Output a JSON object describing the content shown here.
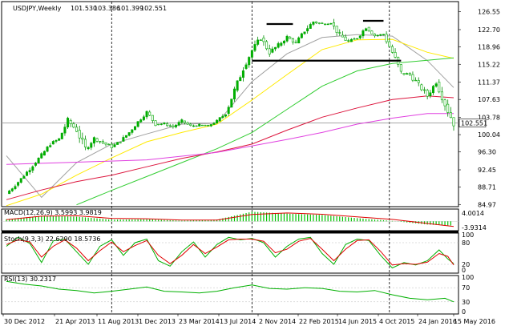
{
  "chart_data": {
    "type": "line",
    "header": {
      "symbol": "USDJPY,Weekly",
      "open": "101.530",
      "high": "103.386",
      "low": "101.399",
      "close": "102.551"
    },
    "price_axis": {
      "ticks": [
        126.55,
        122.7,
        118.96,
        115.22,
        111.37,
        107.63,
        103.78,
        100.04,
        96.3,
        92.45,
        88.71,
        84.97
      ],
      "tick_labels": [
        "126.55",
        "122.70",
        "118.96",
        "115.22",
        "111.37",
        "107.63",
        "103.78",
        "100.04",
        "96.30",
        "92.45",
        "88.71",
        "84.97"
      ],
      "ylim": [
        84.5,
        128.4
      ],
      "current_price_label": "102.551",
      "current_price": 102.551
    },
    "x_axis": {
      "labels": [
        "30 Dec 2012",
        "21 Apr 2013",
        "11 Aug 2013",
        "1 Dec 2013",
        "23 Mar 2014",
        "13 Jul 2014",
        "2 Nov 2014",
        "22 Feb 2015",
        "14 Jun 2015",
        "4 Oct 2015",
        "24 Jan 2016",
        "15 May 2016"
      ],
      "dashed_separators": [
        "1 Dec 2013",
        "2 Nov 2014",
        "24 Jan 2016"
      ]
    },
    "price_series": [
      {
        "t": 0,
        "o": 85.5,
        "h": 87.8,
        "l": 85.0,
        "c": 87.3
      },
      {
        "t": 3,
        "o": 87.3,
        "h": 89.5,
        "l": 86.9,
        "c": 89.1
      },
      {
        "t": 6,
        "o": 89.1,
        "h": 91.8,
        "l": 88.8,
        "c": 91.2
      },
      {
        "t": 9,
        "o": 91.2,
        "h": 94.0,
        "l": 90.6,
        "c": 93.4
      },
      {
        "t": 12,
        "o": 93.4,
        "h": 96.2,
        "l": 92.8,
        "c": 95.6
      },
      {
        "t": 15,
        "o": 95.6,
        "h": 98.4,
        "l": 95.0,
        "c": 98.0
      },
      {
        "t": 18,
        "o": 98.0,
        "h": 99.6,
        "l": 96.8,
        "c": 99.1
      },
      {
        "t": 21,
        "o": 99.1,
        "h": 103.7,
        "l": 98.4,
        "c": 103.1
      },
      {
        "t": 24,
        "o": 103.1,
        "h": 103.7,
        "l": 98.6,
        "c": 101.0
      },
      {
        "t": 27,
        "o": 101.0,
        "h": 101.6,
        "l": 94.5,
        "c": 97.0
      },
      {
        "t": 30,
        "o": 97.0,
        "h": 99.8,
        "l": 95.2,
        "c": 99.2
      },
      {
        "t": 33,
        "o": 99.2,
        "h": 100.6,
        "l": 97.8,
        "c": 98.3
      },
      {
        "t": 36,
        "o": 98.3,
        "h": 99.5,
        "l": 96.3,
        "c": 97.4
      },
      {
        "t": 39,
        "o": 97.4,
        "h": 99.2,
        "l": 96.6,
        "c": 98.6
      },
      {
        "t": 42,
        "o": 98.6,
        "h": 101.3,
        "l": 98.1,
        "c": 100.5
      },
      {
        "t": 45,
        "o": 100.5,
        "h": 103.2,
        "l": 100.0,
        "c": 102.8
      },
      {
        "t": 48,
        "o": 102.8,
        "h": 105.4,
        "l": 102.3,
        "c": 104.9
      },
      {
        "t": 51,
        "o": 104.9,
        "h": 105.3,
        "l": 101.8,
        "c": 102.3
      },
      {
        "t": 54,
        "o": 102.3,
        "h": 103.4,
        "l": 101.4,
        "c": 102.4
      },
      {
        "t": 57,
        "o": 102.4,
        "h": 103.1,
        "l": 100.8,
        "c": 101.7
      },
      {
        "t": 60,
        "o": 101.7,
        "h": 103.6,
        "l": 101.2,
        "c": 103.0
      },
      {
        "t": 63,
        "o": 103.0,
        "h": 103.6,
        "l": 101.4,
        "c": 101.9
      },
      {
        "t": 66,
        "o": 101.9,
        "h": 102.8,
        "l": 101.1,
        "c": 102.1
      },
      {
        "t": 69,
        "o": 102.1,
        "h": 102.9,
        "l": 101.4,
        "c": 101.9
      },
      {
        "t": 72,
        "o": 101.9,
        "h": 103.4,
        "l": 101.6,
        "c": 103.0
      },
      {
        "t": 75,
        "o": 103.0,
        "h": 105.4,
        "l": 102.5,
        "c": 104.6
      },
      {
        "t": 78,
        "o": 104.6,
        "h": 110.2,
        "l": 104.2,
        "c": 109.6
      },
      {
        "t": 81,
        "o": 109.6,
        "h": 114.8,
        "l": 108.9,
        "c": 114.3
      },
      {
        "t": 84,
        "o": 114.3,
        "h": 118.8,
        "l": 113.8,
        "c": 118.2
      },
      {
        "t": 87,
        "o": 118.2,
        "h": 121.8,
        "l": 116.8,
        "c": 120.9
      },
      {
        "t": 90,
        "o": 120.9,
        "h": 121.4,
        "l": 116.0,
        "c": 117.8
      },
      {
        "t": 93,
        "o": 117.8,
        "h": 121.0,
        "l": 117.0,
        "c": 119.3
      },
      {
        "t": 96,
        "o": 119.3,
        "h": 122.0,
        "l": 118.6,
        "c": 121.1
      },
      {
        "t": 99,
        "o": 121.1,
        "h": 121.6,
        "l": 118.4,
        "c": 119.8
      },
      {
        "t": 102,
        "o": 119.8,
        "h": 122.9,
        "l": 119.3,
        "c": 122.4
      },
      {
        "t": 105,
        "o": 122.4,
        "h": 125.9,
        "l": 121.9,
        "c": 124.4
      },
      {
        "t": 108,
        "o": 124.4,
        "h": 125.1,
        "l": 122.6,
        "c": 123.9
      },
      {
        "t": 111,
        "o": 123.9,
        "h": 124.8,
        "l": 122.9,
        "c": 124.2
      },
      {
        "t": 114,
        "o": 124.2,
        "h": 125.4,
        "l": 120.6,
        "c": 121.5
      },
      {
        "t": 117,
        "o": 121.5,
        "h": 122.0,
        "l": 116.5,
        "c": 120.1
      },
      {
        "t": 120,
        "o": 120.1,
        "h": 121.7,
        "l": 119.4,
        "c": 120.9
      },
      {
        "t": 123,
        "o": 120.9,
        "h": 123.9,
        "l": 120.4,
        "c": 123.2
      },
      {
        "t": 126,
        "o": 123.2,
        "h": 123.6,
        "l": 120.8,
        "c": 121.4
      },
      {
        "t": 129,
        "o": 121.4,
        "h": 122.2,
        "l": 120.6,
        "c": 121.7
      },
      {
        "t": 132,
        "o": 121.7,
        "h": 121.9,
        "l": 116.0,
        "c": 117.8
      },
      {
        "t": 135,
        "o": 117.8,
        "h": 118.4,
        "l": 110.9,
        "c": 113.3
      },
      {
        "t": 138,
        "o": 113.3,
        "h": 114.6,
        "l": 111.4,
        "c": 113.0
      },
      {
        "t": 141,
        "o": 113.0,
        "h": 113.5,
        "l": 108.7,
        "c": 110.8
      },
      {
        "t": 144,
        "o": 110.8,
        "h": 112.6,
        "l": 107.8,
        "c": 108.4
      },
      {
        "t": 147,
        "o": 108.4,
        "h": 112.2,
        "l": 107.6,
        "c": 111.4
      },
      {
        "t": 150,
        "o": 111.4,
        "h": 111.9,
        "l": 105.5,
        "c": 106.6
      },
      {
        "t": 153,
        "o": 106.6,
        "h": 107.0,
        "l": 99.0,
        "c": 102.551
      }
    ],
    "moving_averages": [
      {
        "name": "MA gray",
        "color": "#a0a0a0",
        "points": [
          [
            0,
            95.5
          ],
          [
            12,
            86.5
          ],
          [
            24,
            94.0
          ],
          [
            36,
            98.0
          ],
          [
            48,
            100.2
          ],
          [
            60,
            102.3
          ],
          [
            72,
            102.5
          ],
          [
            84,
            111.5
          ],
          [
            96,
            117.5
          ],
          [
            108,
            121.0
          ],
          [
            120,
            121.6
          ],
          [
            132,
            121.3
          ],
          [
            144,
            116.0
          ],
          [
            153,
            110.2
          ]
        ]
      },
      {
        "name": "MA yellow",
        "color": "#ffea00",
        "points": [
          [
            0,
            84.7
          ],
          [
            12,
            87.2
          ],
          [
            24,
            91.3
          ],
          [
            36,
            95.0
          ],
          [
            48,
            98.5
          ],
          [
            60,
            100.5
          ],
          [
            72,
            102.3
          ],
          [
            84,
            107.5
          ],
          [
            96,
            113.0
          ],
          [
            108,
            118.4
          ],
          [
            120,
            120.5
          ],
          [
            132,
            120.6
          ],
          [
            144,
            117.8
          ],
          [
            153,
            116.5
          ]
        ]
      },
      {
        "name": "MA green",
        "color": "#32cd32",
        "points": [
          [
            24,
            84.9
          ],
          [
            36,
            88.0
          ],
          [
            48,
            91.0
          ],
          [
            60,
            94.0
          ],
          [
            72,
            97.0
          ],
          [
            84,
            100.5
          ],
          [
            96,
            105.5
          ],
          [
            108,
            110.5
          ],
          [
            120,
            113.8
          ],
          [
            132,
            115.4
          ],
          [
            144,
            116.1
          ],
          [
            153,
            116.6
          ]
        ]
      },
      {
        "name": "MA red",
        "color": "#dc143c",
        "points": [
          [
            0,
            86.0
          ],
          [
            12,
            88.1
          ],
          [
            24,
            89.9
          ],
          [
            36,
            91.3
          ],
          [
            48,
            93.1
          ],
          [
            60,
            94.9
          ],
          [
            72,
            96.3
          ],
          [
            84,
            98.0
          ],
          [
            96,
            101.0
          ],
          [
            108,
            103.8
          ],
          [
            120,
            105.8
          ],
          [
            132,
            107.6
          ],
          [
            144,
            108.4
          ],
          [
            153,
            108.0
          ]
        ]
      },
      {
        "name": "MA magenta",
        "color": "#e040e0",
        "points": [
          [
            0,
            93.6
          ],
          [
            24,
            94.1
          ],
          [
            48,
            94.6
          ],
          [
            72,
            96.2
          ],
          [
            96,
            99.0
          ],
          [
            108,
            100.5
          ],
          [
            120,
            102.3
          ],
          [
            132,
            103.6
          ],
          [
            144,
            104.6
          ],
          [
            153,
            104.6
          ]
        ]
      }
    ],
    "annotations": {
      "support_line": {
        "price": 116.0,
        "t_start": 84,
        "t_end": 135
      },
      "tops": [
        {
          "price": 123.9,
          "t_start": 89,
          "t_end": 98
        },
        {
          "price": 124.6,
          "t_start": 122,
          "t_end": 129
        }
      ]
    },
    "macd": {
      "label": "MACD(12,26,9) 3.5993 3.9819",
      "ticks": [
        "4.0014",
        "-3.9314"
      ],
      "hist": [
        [
          0,
          1.0
        ],
        [
          12,
          2.6
        ],
        [
          24,
          2.2
        ],
        [
          36,
          0.8
        ],
        [
          48,
          1.0
        ],
        [
          60,
          0.3
        ],
        [
          72,
          0.8
        ],
        [
          84,
          4.5
        ],
        [
          96,
          3.6
        ],
        [
          108,
          3.0
        ],
        [
          120,
          1.5
        ],
        [
          132,
          0.2
        ],
        [
          144,
          -1.5
        ],
        [
          153,
          -2.0
        ]
      ],
      "signal": [
        [
          0,
          0.8
        ],
        [
          12,
          2.4
        ],
        [
          24,
          2.6
        ],
        [
          36,
          1.4
        ],
        [
          48,
          1.2
        ],
        [
          60,
          0.6
        ],
        [
          72,
          0.6
        ],
        [
          84,
          3.2
        ],
        [
          96,
          3.9
        ],
        [
          108,
          3.3
        ],
        [
          120,
          2.1
        ],
        [
          132,
          0.9
        ],
        [
          144,
          -1.0
        ],
        [
          153,
          -2.4
        ]
      ]
    },
    "stochastic": {
      "label": "Stoch(9,3,3) 22.6290 18.5736",
      "ticks": [
        "100",
        "80",
        "20",
        "0"
      ],
      "k": [
        [
          0,
          70
        ],
        [
          4,
          95
        ],
        [
          8,
          78
        ],
        [
          12,
          25
        ],
        [
          16,
          85
        ],
        [
          20,
          90
        ],
        [
          24,
          55
        ],
        [
          28,
          20
        ],
        [
          32,
          70
        ],
        [
          36,
          88
        ],
        [
          40,
          45
        ],
        [
          44,
          80
        ],
        [
          48,
          90
        ],
        [
          52,
          30
        ],
        [
          56,
          15
        ],
        [
          60,
          55
        ],
        [
          64,
          82
        ],
        [
          68,
          40
        ],
        [
          72,
          75
        ],
        [
          76,
          95
        ],
        [
          80,
          88
        ],
        [
          84,
          92
        ],
        [
          88,
          80
        ],
        [
          92,
          40
        ],
        [
          96,
          70
        ],
        [
          100,
          90
        ],
        [
          104,
          95
        ],
        [
          108,
          50
        ],
        [
          112,
          20
        ],
        [
          116,
          75
        ],
        [
          120,
          90
        ],
        [
          124,
          86
        ],
        [
          128,
          45
        ],
        [
          132,
          10
        ],
        [
          136,
          25
        ],
        [
          140,
          18
        ],
        [
          144,
          30
        ],
        [
          148,
          60
        ],
        [
          151,
          35
        ],
        [
          153,
          22
        ]
      ],
      "d": [
        [
          0,
          75
        ],
        [
          4,
          88
        ],
        [
          8,
          82
        ],
        [
          12,
          40
        ],
        [
          16,
          70
        ],
        [
          20,
          88
        ],
        [
          24,
          65
        ],
        [
          28,
          30
        ],
        [
          32,
          58
        ],
        [
          36,
          82
        ],
        [
          40,
          55
        ],
        [
          44,
          72
        ],
        [
          48,
          86
        ],
        [
          52,
          45
        ],
        [
          56,
          22
        ],
        [
          60,
          45
        ],
        [
          64,
          75
        ],
        [
          68,
          50
        ],
        [
          72,
          68
        ],
        [
          76,
          88
        ],
        [
          80,
          90
        ],
        [
          84,
          90
        ],
        [
          88,
          84
        ],
        [
          92,
          52
        ],
        [
          96,
          62
        ],
        [
          100,
          84
        ],
        [
          104,
          92
        ],
        [
          108,
          62
        ],
        [
          112,
          30
        ],
        [
          116,
          62
        ],
        [
          120,
          86
        ],
        [
          124,
          88
        ],
        [
          128,
          56
        ],
        [
          132,
          18
        ],
        [
          136,
          22
        ],
        [
          140,
          20
        ],
        [
          144,
          26
        ],
        [
          148,
          50
        ],
        [
          151,
          42
        ],
        [
          153,
          18
        ]
      ]
    },
    "rsi": {
      "label": "RSI(13) 30.2317",
      "ticks": [
        "100",
        "70",
        "30",
        "0"
      ],
      "values": [
        [
          0,
          88
        ],
        [
          6,
          80
        ],
        [
          12,
          75
        ],
        [
          18,
          66
        ],
        [
          24,
          62
        ],
        [
          30,
          55
        ],
        [
          36,
          60
        ],
        [
          42,
          66
        ],
        [
          48,
          72
        ],
        [
          54,
          60
        ],
        [
          60,
          58
        ],
        [
          66,
          55
        ],
        [
          72,
          60
        ],
        [
          78,
          70
        ],
        [
          84,
          78
        ],
        [
          90,
          68
        ],
        [
          96,
          66
        ],
        [
          102,
          70
        ],
        [
          108,
          68
        ],
        [
          114,
          60
        ],
        [
          120,
          58
        ],
        [
          126,
          62
        ],
        [
          132,
          50
        ],
        [
          138,
          40
        ],
        [
          144,
          36
        ],
        [
          150,
          40
        ],
        [
          153,
          30
        ]
      ]
    }
  }
}
